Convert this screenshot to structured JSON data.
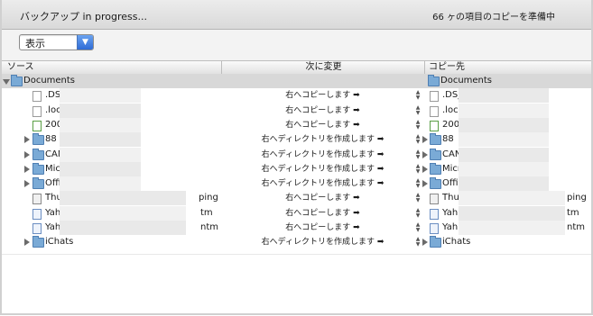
{
  "status": {
    "title": "バックアップ in progress...",
    "detail": "66 ヶの項目のコピーを準備中"
  },
  "view_menu": {
    "selected": "表示"
  },
  "columns": {
    "source": "ソース",
    "change": "次に変更",
    "destination": "コピー先"
  },
  "rows": [
    {
      "kind": "root",
      "expanded": true,
      "icon": "folder-icon",
      "source": "Documents",
      "action": "",
      "destination": "Documents"
    },
    {
      "kind": "file",
      "icon": "document-icon",
      "source": ".DS_",
      "action": "右へコピーします ➡",
      "destination": ".DS_"
    },
    {
      "kind": "file",
      "icon": "document-icon",
      "source": ".loc",
      "action": "右へコピーします ➡",
      "destination": ".loc"
    },
    {
      "kind": "file",
      "icon": "spreadsheet-icon",
      "source": "200",
      "action": "右へコピーします ➡",
      "destination": "200"
    },
    {
      "kind": "folder",
      "icon": "folder-icon",
      "source": "88",
      "action": "右へディレクトリを作成します ➡",
      "destination": "88"
    },
    {
      "kind": "folder",
      "icon": "folder-icon",
      "source": "CAN",
      "action": "右へディレクトリを作成します ➡",
      "destination": "CAN"
    },
    {
      "kind": "folder",
      "icon": "folder-icon",
      "source": "Micr",
      "action": "右へディレクトリを作成します ➡",
      "destination": "Micr"
    },
    {
      "kind": "folder",
      "icon": "folder-icon",
      "source": "Offi",
      "action": "右へディレクトリを作成します ➡",
      "destination": "Offi"
    },
    {
      "kind": "file",
      "icon": "text-document-icon",
      "source": "Thu",
      "source_tail": "ping",
      "action": "右へコピーします ➡",
      "destination": "Thu",
      "destination_tail": "ping"
    },
    {
      "kind": "file",
      "icon": "web-document-icon",
      "source": "Yah",
      "source_tail": "tm",
      "action": "右へコピーします ➡",
      "destination": "Yah",
      "destination_tail": "tm"
    },
    {
      "kind": "file",
      "icon": "web-document-icon",
      "source": "Yah",
      "source_tail": "ntm",
      "action": "右へコピーします ➡",
      "destination": "Yah",
      "destination_tail": "ntm"
    },
    {
      "kind": "folder",
      "icon": "folder-icon",
      "source": "iChats",
      "action": "右へディレクトリを作成します ➡",
      "destination": "iChats"
    }
  ]
}
